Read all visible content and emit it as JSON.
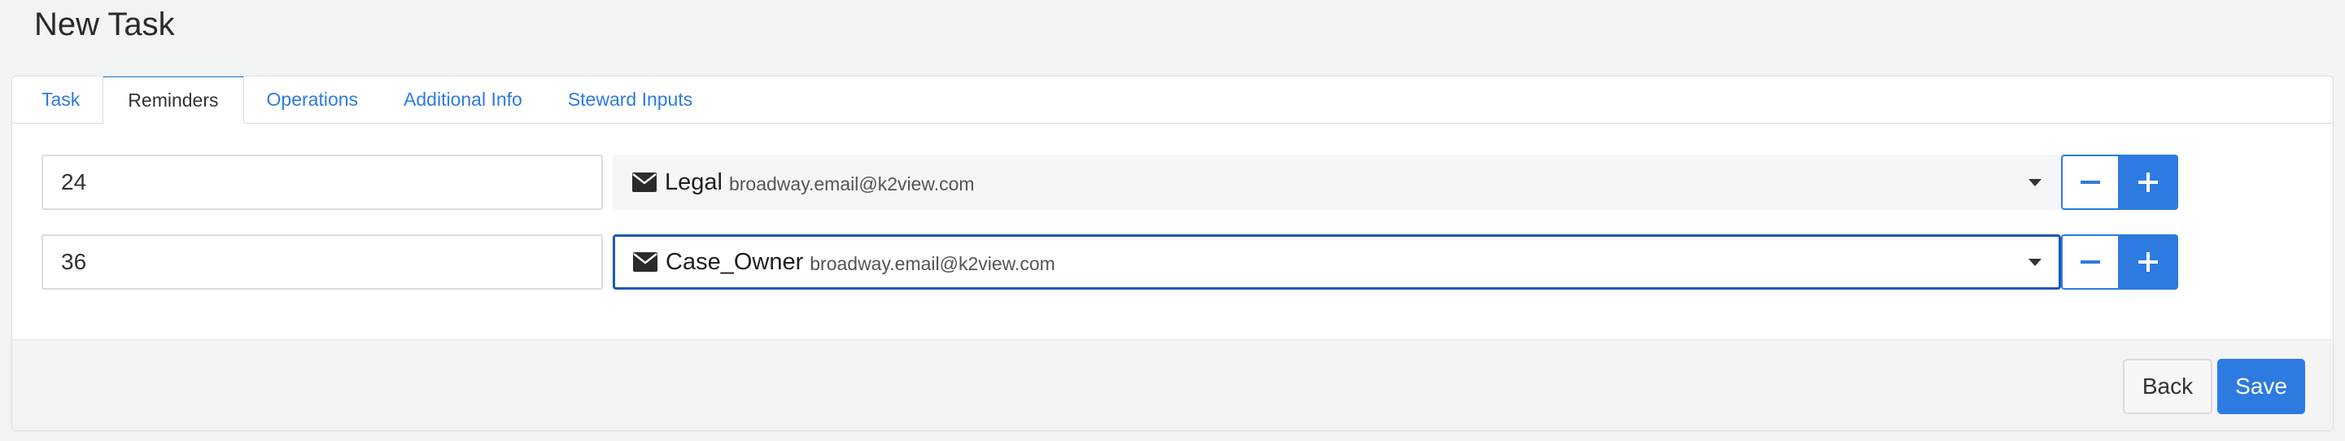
{
  "page": {
    "title": "New Task"
  },
  "tabs": [
    {
      "label": "Task"
    },
    {
      "label": "Reminders",
      "active": true
    },
    {
      "label": "Operations"
    },
    {
      "label": "Additional Info"
    },
    {
      "label": "Steward Inputs"
    }
  ],
  "reminders": [
    {
      "hours": "24",
      "recipient_name": "Legal",
      "recipient_email": "broadway.email@k2view.com",
      "icon": "envelope-icon"
    },
    {
      "hours": "36",
      "recipient_name": "Case_Owner",
      "recipient_email": "broadway.email@k2view.com",
      "icon": "envelope-icon"
    }
  ],
  "footer": {
    "back_label": "Back",
    "save_label": "Save"
  },
  "colors": {
    "accent": "#2d7be0",
    "focus_border": "#1f57b3",
    "select_bg": "#f5f6f7"
  }
}
